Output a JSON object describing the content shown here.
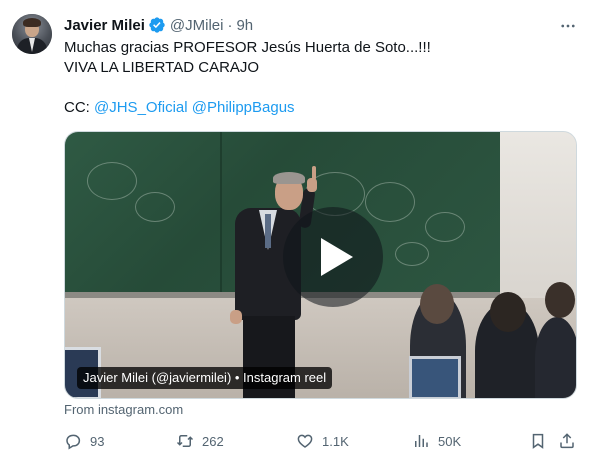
{
  "author": {
    "name": "Javier Milei",
    "handle": "@JMilei",
    "separator": "·",
    "time": "9h",
    "verified": true
  },
  "tweet": {
    "line1": "Muchas gracias PROFESOR Jesús Huerta de Soto...!!!",
    "line2": "VIVA LA LIBERTAD CARAJO",
    "cc_prefix": "CC: ",
    "mention1": "@JHS_Oficial",
    "mention2": "@PhilippBagus"
  },
  "media": {
    "caption": "Javier Milei (@javiermilei) • Instagram reel",
    "source": "From instagram.com",
    "play_icon": "play-icon"
  },
  "actions": {
    "replies": "93",
    "reposts": "262",
    "likes": "1.1K",
    "views": "50K",
    "icons": [
      "reply-icon",
      "repost-icon",
      "like-icon",
      "views-icon",
      "bookmark-icon",
      "share-icon"
    ]
  },
  "colors": {
    "text": "#0f1419",
    "secondary": "#536471",
    "link": "#1d9bf0",
    "verified": "#1d9bf0"
  }
}
